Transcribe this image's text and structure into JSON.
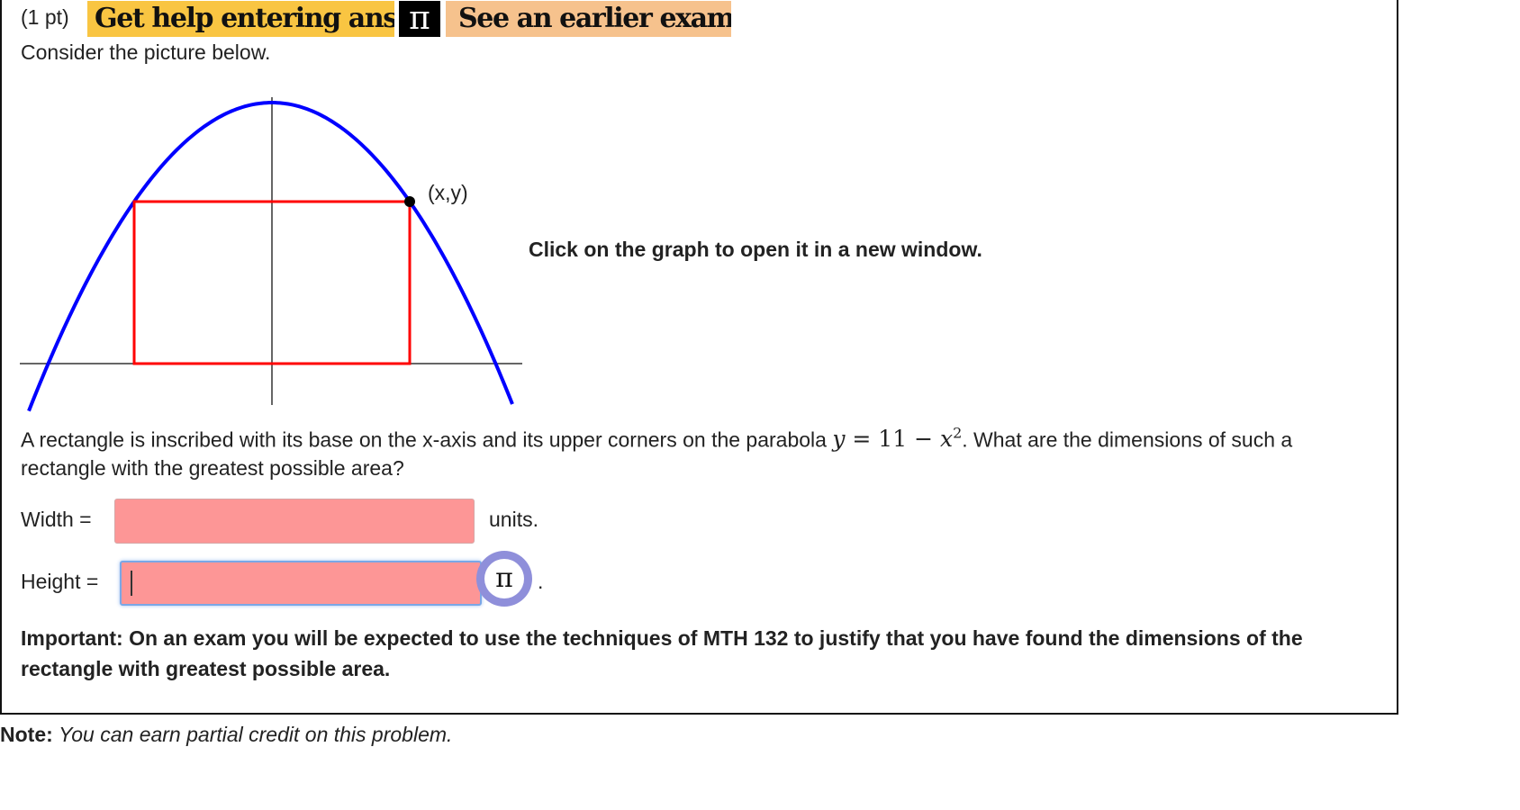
{
  "header": {
    "points": "(1 pt)",
    "help_label": "Get help entering answers",
    "pi_symbol": "π",
    "example_label": "See an earlier example",
    "help_color": "#f9c542",
    "example_color": "#f6c28d"
  },
  "intro": "Consider the picture below.",
  "figure": {
    "point_label": "(x,y)",
    "curve_color": "#0000ff",
    "rect_color": "#ff0000"
  },
  "graph_hint": "Click on the graph to open it in a new window.",
  "problem": {
    "text_before": "A rectangle is inscribed with its base on the x-axis and its upper corners on the parabola",
    "eq_y": "y",
    "eq_eq": " = 11 − ",
    "eq_x": "x",
    "eq_exp": "2",
    "text_after": ". What are the dimensions of such a",
    "text_line2": "rectangle with the greatest possible area?"
  },
  "answers": {
    "width_label": "Width =",
    "width_value": "",
    "width_units": "units.",
    "height_label": "Height =",
    "height_value": "",
    "height_units_visible": ".",
    "pi_button": "π",
    "input_color": "#fd9696"
  },
  "important": {
    "line1": "Important: On an exam you will be expected to use the techniques of MTH 132 to justify that you have found the dimensions of the",
    "line2": "rectangle with greatest possible area."
  },
  "note": {
    "label": "Note:",
    "text": "You can earn partial credit on this problem."
  }
}
